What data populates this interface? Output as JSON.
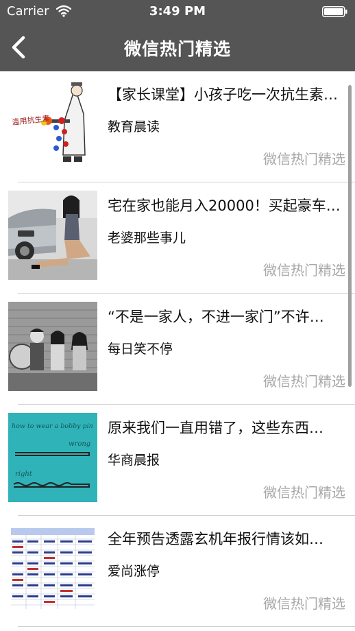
{
  "status_bar": {
    "carrier": "Carrier",
    "time": "3:49 PM"
  },
  "nav": {
    "title": "微信热门精选",
    "back_icon": "chevron-left-icon"
  },
  "articles": [
    {
      "title": "【家长课堂】小孩子吃一次抗生素…",
      "source": "教育晨读",
      "tag": "微信热门精选",
      "thumb_caption": "滥用抗生素"
    },
    {
      "title": "宅在家也能月入20000！买起豪车…",
      "source": "老婆那些事儿",
      "tag": "微信热门精选"
    },
    {
      "title": "“不是一家人，不进一家门”不许…",
      "source": "每日笑不停",
      "tag": "微信热门精选"
    },
    {
      "title": "原来我们一直用错了，这些东西…",
      "source": "华商晨报",
      "tag": "微信热门精选",
      "thumb_texts": [
        "how to wear a bobby pin",
        "wrong",
        "right"
      ]
    },
    {
      "title": "全年预告透露玄机年报行情该如…",
      "source": "爱尚涨停",
      "tag": "微信热门精选"
    }
  ],
  "colors": {
    "nav_background": "#555555",
    "tag_gray": "#a8a8a8",
    "divider": "#d0d0d0"
  }
}
